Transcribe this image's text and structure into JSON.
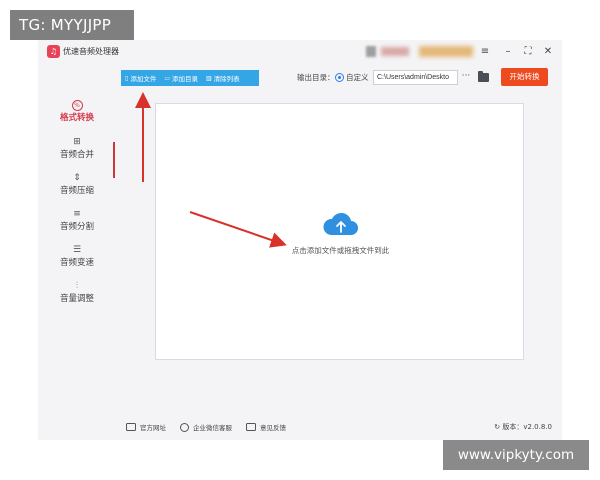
{
  "watermark": {
    "tg": "TG: MYYJJPP",
    "site": "www.vipkyty.com"
  },
  "app": {
    "title": "优速音频处理器",
    "logo_glyph": "♫"
  },
  "window_controls": {
    "menu": "≡",
    "minimize": "–",
    "maximize": "⛶",
    "close": "✕"
  },
  "sidebar": {
    "items": [
      {
        "label": "格式转换",
        "icon": "format-convert-icon",
        "glyph": "%",
        "active": true
      },
      {
        "label": "音频合并",
        "icon": "merge-icon",
        "glyph": "⊞"
      },
      {
        "label": "音频压缩",
        "icon": "compress-icon",
        "glyph": "⇕"
      },
      {
        "label": "音频分割",
        "icon": "split-icon",
        "glyph": "≡"
      },
      {
        "label": "音频变速",
        "icon": "speed-icon",
        "glyph": "☰"
      },
      {
        "label": "音量调整",
        "icon": "volume-icon",
        "glyph": "⫶"
      }
    ]
  },
  "toolbar": {
    "add_file": "添加文件",
    "add_folder": "添加目录",
    "clear_list": "清除列表"
  },
  "output": {
    "label": "输出目录：",
    "option_custom": "自定义",
    "path": "C:\\Users\\admin\\Deskto",
    "browse": "···"
  },
  "start_button": "开始转换",
  "drop_area": {
    "hint": "点击添加文件或拖拽文件到此"
  },
  "footer": {
    "website": "官方网址",
    "wechat_support": "企业微信客服",
    "feedback": "意见反馈",
    "version": "版本：v2.0.8.0"
  },
  "colors": {
    "accent_blue": "#35a6e5",
    "start_orange": "#ee4a1f",
    "active_red": "#d43a4c",
    "annotation_red": "#d9322b"
  }
}
